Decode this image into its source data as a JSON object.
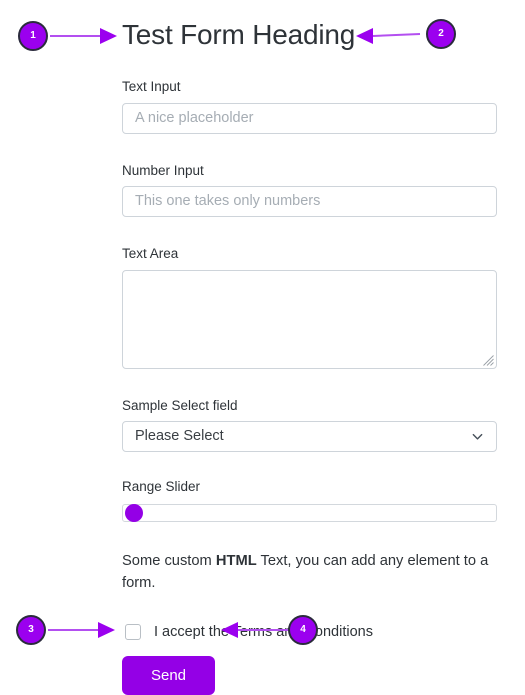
{
  "page": {
    "title": "Test Form Heading"
  },
  "fields": {
    "text_input": {
      "label": "Text Input",
      "placeholder": "A nice placeholder",
      "value": ""
    },
    "number_input": {
      "label": "Number Input",
      "placeholder": "This one takes only numbers",
      "value": ""
    },
    "text_area": {
      "label": "Text Area",
      "placeholder": "",
      "value": ""
    },
    "select": {
      "label": "Sample Select field",
      "selected": "Please Select",
      "icon": "chevron-down-icon"
    },
    "range": {
      "label": "Range Slider",
      "value": "0",
      "min": "0",
      "max": "100"
    }
  },
  "custom_html": {
    "before": "Some custom ",
    "bold": "HTML",
    "after": " Text, you can add any element to a form."
  },
  "consent": {
    "label": "I accept the Terms and Conditions",
    "checked": "false"
  },
  "submit": {
    "label": "Send"
  },
  "annotations": {
    "markers": [
      {
        "number": "1"
      },
      {
        "number": "2"
      },
      {
        "number": "3"
      },
      {
        "number": "4"
      }
    ],
    "accent_color": "#9b00ef",
    "arrow_color": "#b34ff0"
  }
}
